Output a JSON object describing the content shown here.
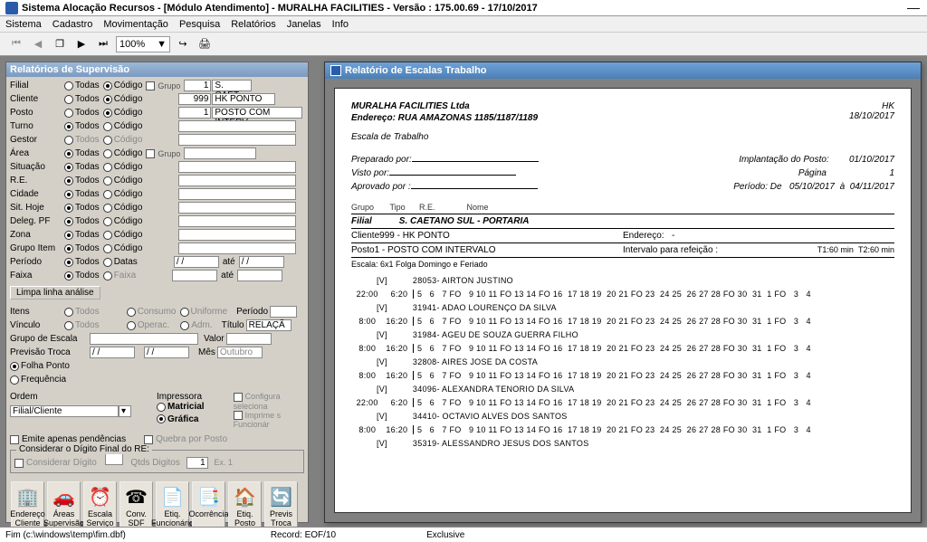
{
  "window": {
    "title": "Sistema Alocação Recursos  -  [Módulo Atendimento]  -   MURALHA FACILITIES - Versão : 175.00.69 - 17/10/2017",
    "minimize": "—"
  },
  "menu": {
    "sistema": "Sistema",
    "cadastro": "Cadastro",
    "movimentacao": "Movimentação",
    "pesquisa": "Pesquisa",
    "relatorios": "Relatórios",
    "janelas": "Janelas",
    "info": "Info"
  },
  "toolbar": {
    "zoom": "100%",
    "zoomarrow": "▼"
  },
  "leftpanel": {
    "title": "Relatórios de Supervisão",
    "labels": {
      "filial": "Filial",
      "cliente": "Cliente",
      "posto": "Posto",
      "turno": "Turno",
      "gestor": "Gestor",
      "area": "Área",
      "situacao": "Situação",
      "re": "R.E.",
      "cidade": "Cidade",
      "sithoje": "Sit. Hoje",
      "delegpf": "Deleg. PF",
      "zona": "Zona",
      "grupoitem": "Grupo Item",
      "periodo": "Período",
      "faixa": "Faixa",
      "itens": "Itens",
      "vinculo": "Vínculo",
      "grupoescala": "Grupo de Escala",
      "previsaotroca": "Previsão Troca",
      "ordem": "Ordem"
    },
    "radios": {
      "todas": "Todas",
      "todos": "Todos",
      "codigo": "Código",
      "grupo": "Grupo",
      "datas": "Datas",
      "faixa": "Faixa",
      "consumo": "Consumo",
      "uniforme": "Uniforme",
      "operac": "Operac.",
      "adm": "Adm.",
      "folhaponto": "Folha Ponto",
      "frequencia": "Frequência",
      "matricial": "Matricial",
      "grafica": "Gráfica"
    },
    "vals": {
      "filialcodigo": "1",
      "filialnome": "S. CAET",
      "clientecodigo": "999",
      "clientenome": "HK PONTO",
      "postocodigo": "1",
      "postonome": "POSTO COM INTERV"
    },
    "ate": "até",
    "limpalinha": "Limpa linha análise",
    "periodolbl": "Período",
    "titulo": "Título",
    "titulovall": "RELAÇÃ",
    "valor": "Valor",
    "mes": "Mês",
    "mesval": "Outubro",
    "impressora": "Impressora",
    "configura": "Configura",
    "seleciona": "seleciona",
    "imprimes": "Imprime s",
    "funcionar": "Funcionár",
    "emite": "Emite apenas pendências",
    "quebra": "Quebra por Posto",
    "considerar": "Considerar o Dígito Final do RE:",
    "considerardigito": "Considerar Dígito",
    "qtdsdigitos": "Qtds Digitos",
    "qtdsval": "1",
    "exlbl": "Ex. 1",
    "filialcliente": "Filial/Cliente",
    "datesep": "/  /",
    "icons": {
      "endereco": {
        "lbl1": "Endereço",
        "lbl2": "Cliente"
      },
      "areas": {
        "lbl1": "Áreas",
        "lbl2": "Supervisão"
      },
      "escala": {
        "lbl1": "Escala",
        "lbl2": "Serviço"
      },
      "conv": {
        "lbl1": "Conv.",
        "lbl2": "SDF"
      },
      "etiq": {
        "lbl1": "Etiq.",
        "lbl2": "Funcionário"
      },
      "ocorr": {
        "lbl1": "Ocorrência",
        "lbl2": ""
      },
      "etiqp": {
        "lbl1": "Etiq.",
        "lbl2": "Posto"
      },
      "previs": {
        "lbl1": "Previs",
        "lbl2": "Troca"
      }
    }
  },
  "report": {
    "wintitle": "Relatório de Escalas Trabalho",
    "company": "MURALHA FACILITIES Ltda",
    "hk": "HK",
    "address": "Endereço: RUA AMAZONAS 1185/1187/1189",
    "date": "18/10/2017",
    "escala": "Escala de Trabalho",
    "preparado": "Preparado por:",
    "implantacao": "Implantação do Posto:",
    "implantval": "01/10/2017",
    "visto": "Visto por:",
    "pagina": "Página",
    "paginaval": "1",
    "aprovado": "Aprovado por :",
    "periodo": "Período:  De",
    "perde": "05/10/2017",
    "pera": "à",
    "perate": "04/11/2017",
    "colgrupo": "Grupo",
    "coltipo": "Tipo",
    "colre": "R.E.",
    "colnome": "Nome",
    "filiallbl": "Filial",
    "filialval": "S. CAETANO SUL - PORTARIA",
    "clientelbl": "Cliente",
    "clienteval": "999  -  HK PONTO",
    "enderecolbl": "Endereço:",
    "enderecoval": "-",
    "postolbl": "Posto",
    "postoval": "1  -  POSTO COM INTERVALO",
    "intervalolbl": "Intervalo para refeição :",
    "t1": "T1:60 min",
    "t2": "T2:60 min",
    "escalainfo": "Escala: 6x1 Folga Domingo e Feriado",
    "rows": [
      {
        "tag": "[V]",
        "re": "28053-",
        "nome": "AIRTON JUSTINO",
        "h1": "22:00",
        "h2": "6:20",
        "line": "5   6   7 FO   9 10 11 FO 13 14 FO 16  17 18 19  20 21 FO 23  24 25  26 27 28 FO 30  31  1 FO   3   4"
      },
      {
        "tag": "[V]",
        "re": "31941-",
        "nome": "ADAO LOURENÇO DA SILVA",
        "h1": "8:00",
        "h2": "16:20",
        "line": "5   6   7 FO   9 10 11 FO 13 14 FO 16  17 18 19  20 21 FO 23  24 25  26 27 28 FO 30  31  1 FO   3   4"
      },
      {
        "tag": "[V]",
        "re": "31984-",
        "nome": "AGEU DE SOUZA GUERRA FILHO",
        "h1": "8:00",
        "h2": "16:20",
        "line": "5   6   7 FO   9 10 11 FO 13 14 FO 16  17 18 19  20 21 FO 23  24 25  26 27 28 FO 30  31  1 FO   3   4"
      },
      {
        "tag": "[V]",
        "re": "32808-",
        "nome": "AIRES JOSE DA COSTA",
        "h1": "8:00",
        "h2": "16:20",
        "line": "5   6   7 FO   9 10 11 FO 13 14 FO 16  17 18 19  20 21 FO 23  24 25  26 27 28 FO 30  31  1 FO   3   4"
      },
      {
        "tag": "[V]",
        "re": "34096-",
        "nome": "ALEXANDRA TENORIO DA SILVA",
        "h1": "22:00",
        "h2": "6:20",
        "line": "5   6   7 FO   9 10 11 FO 13 14 FO 16  17 18 19  20 21 FO 23  24 25  26 27 28 FO 30  31  1 FO   3   4"
      },
      {
        "tag": "[V]",
        "re": "34410-",
        "nome": "OCTAVIO ALVES DOS SANTOS",
        "h1": "8:00",
        "h2": "16:20",
        "line": "5   6   7 FO   9 10 11 FO 13 14 FO 16  17 18 19  20 21 FO 23  24 25  26 27 28 FO 30  31  1 FO   3   4"
      },
      {
        "tag": "[V]",
        "re": "35319-",
        "nome": "ALESSANDRO JESUS DOS SANTOS",
        "h1": "",
        "h2": "",
        "line": ""
      }
    ]
  },
  "status": {
    "file": "Fim (c:\\windows\\temp\\fim.dbf)",
    "record": "Record: EOF/10",
    "excl": "Exclusive"
  }
}
